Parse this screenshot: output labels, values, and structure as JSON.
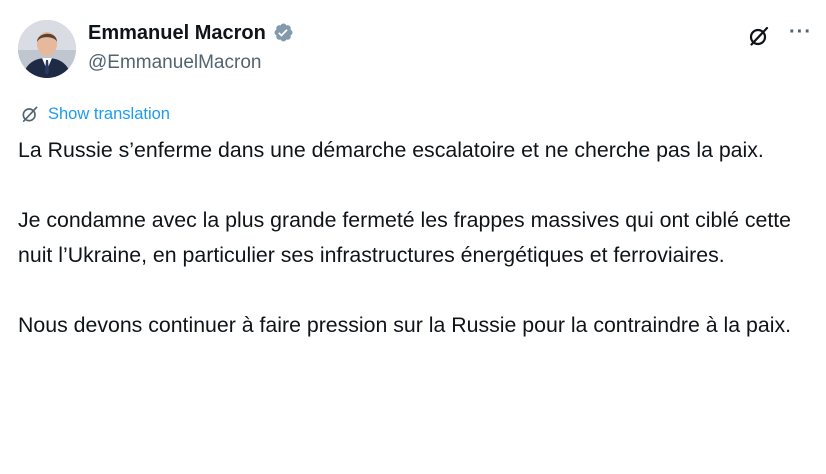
{
  "author": {
    "display_name": "Emmanuel Macron",
    "handle": "@EmmanuelMacron",
    "verified": true
  },
  "actions": {
    "grok_icon": "grok-slash-circle-icon",
    "more_icon": "more-horizontal-icon",
    "more_glyph": "···"
  },
  "translation": {
    "label": "Show translation",
    "icon": "translate-globe-icon"
  },
  "tweet": {
    "paragraphs": [
      "La Russie s’enferme dans une démarche escalatoire et ne cherche pas la paix.",
      "Je condamne avec la plus grande fermeté les frappes massives qui ont ciblé cette nuit l’Ukraine, en particulier ses infrastructures énergétiques et ferroviaires.",
      "Nous devons continuer à faire pression sur la Russie pour la contraindre à la paix."
    ]
  },
  "colors": {
    "text": "#0f1419",
    "secondary": "#536471",
    "link": "#1d9bf0",
    "verified_badge": "#829aab"
  }
}
